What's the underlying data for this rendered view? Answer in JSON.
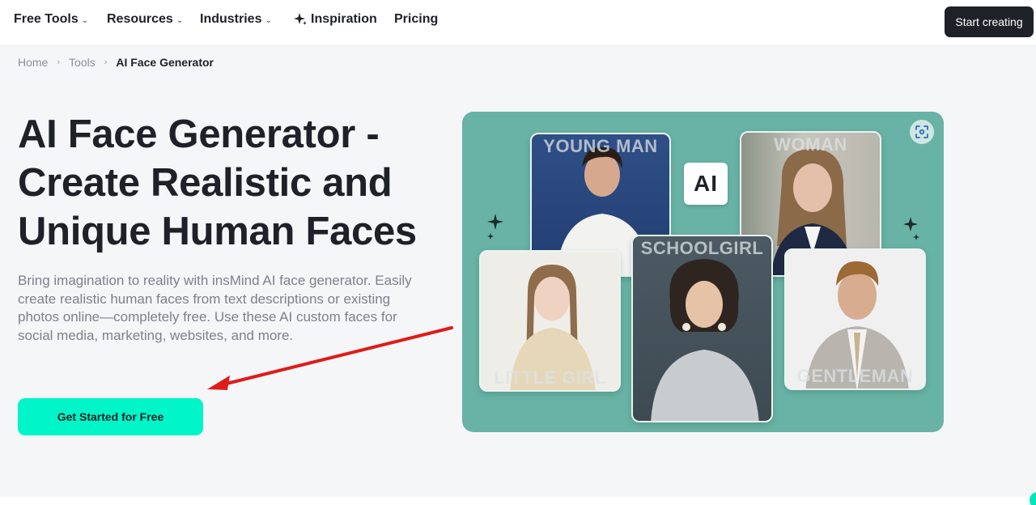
{
  "nav": {
    "items": [
      {
        "label": "Free Tools",
        "has_dropdown": true
      },
      {
        "label": "Resources",
        "has_dropdown": true
      },
      {
        "label": "Industries",
        "has_dropdown": true
      },
      {
        "label": "Inspiration",
        "icon": "sparkle-icon"
      },
      {
        "label": "Pricing"
      }
    ],
    "chevron": "⌄",
    "cta_label": "Start creating"
  },
  "breadcrumb": {
    "items": [
      "Home",
      "Tools",
      "AI Face Generator"
    ],
    "separator": "›"
  },
  "hero": {
    "title": "AI Face Generator - Create Realistic and Unique Human Faces",
    "description": "Bring imagination to reality with insMind AI face generator. Easily create realistic human faces from text descriptions or existing photos online—completely free. Use these AI custom faces for social media, marketing, websites, and more.",
    "cta_label": "Get Started for Free"
  },
  "showcase": {
    "badge": "AI",
    "cards": [
      {
        "label": "YOUNG MAN"
      },
      {
        "label": "WOMAN"
      },
      {
        "label": "LITTLE GIRL"
      },
      {
        "label": "SCHOOLGIRL"
      },
      {
        "label": "GENTLEMAN"
      }
    ]
  },
  "colors": {
    "accent": "#00f5c8",
    "showcase_bg": "#68b3a5",
    "dark": "#1f2128",
    "annotation_arrow": "#e01b1b"
  }
}
